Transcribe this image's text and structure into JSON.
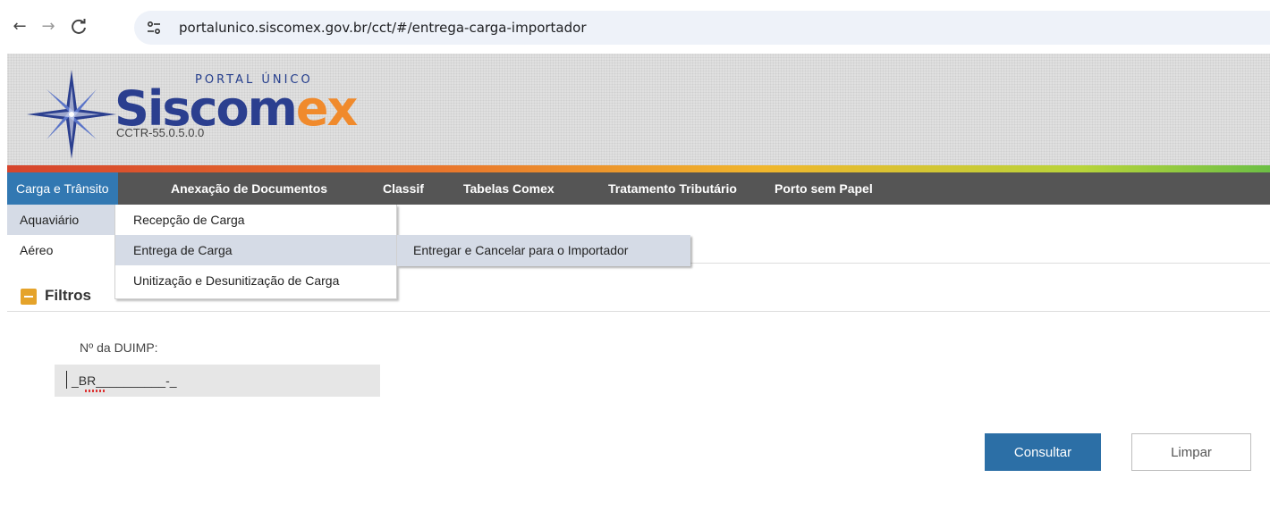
{
  "browser": {
    "url": "portalunico.siscomex.gov.br/cct/#/entrega-carga-importador",
    "back_glyph": "←",
    "forward_glyph": "→",
    "reload_glyph": "C"
  },
  "header": {
    "portal_label": "PORTAL ÚNICO",
    "brand_part1": "Siscom",
    "brand_part2": "ex",
    "version": "CCTR-55.0.5.0.0",
    "brand_colors": {
      "blue": "#2b3f8f",
      "orange": "#f08a2c"
    }
  },
  "menu": {
    "items": [
      {
        "label": "Carga e Trânsito",
        "active": true
      },
      {
        "label": "Anexação de Documentos"
      },
      {
        "label": "Classif"
      },
      {
        "label": "Tabelas Comex"
      },
      {
        "label": "Tratamento Tributário"
      },
      {
        "label": "Porto sem Papel"
      }
    ],
    "active_color": "#3278b2"
  },
  "submenu_level1": [
    {
      "label": "Aquaviário",
      "selected": true
    },
    {
      "label": "Aéreo"
    }
  ],
  "submenu_level2": [
    {
      "label": "Recepção de Carga"
    },
    {
      "label": "Entrega de Carga",
      "selected": true
    },
    {
      "label": "Unitização e Desunitização de Carga"
    }
  ],
  "submenu_level3": [
    {
      "label": "Entregar e Cancelar para o Importador"
    }
  ],
  "filters": {
    "title": "Filtros",
    "duimp_label": "Nº da DUIMP:",
    "duimp_mask": "_BR__________-_",
    "consultar_label": "Consultar",
    "limpar_label": "Limpar"
  }
}
